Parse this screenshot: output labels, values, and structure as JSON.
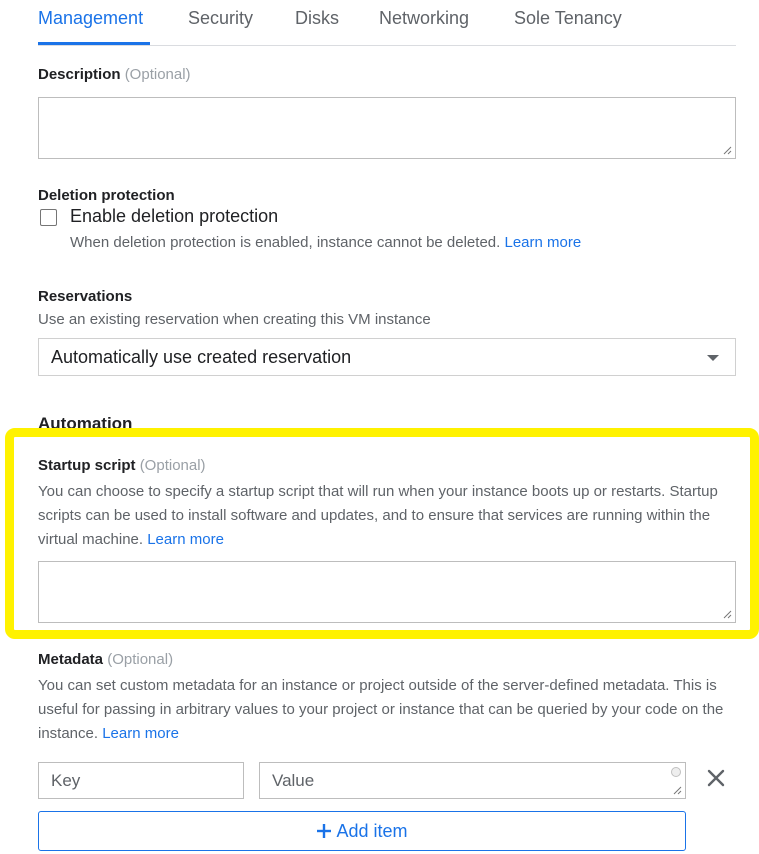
{
  "tabs": [
    {
      "label": "Management",
      "active": true
    },
    {
      "label": "Security",
      "active": false
    },
    {
      "label": "Disks",
      "active": false
    },
    {
      "label": "Networking",
      "active": false
    },
    {
      "label": "Sole Tenancy",
      "active": false
    }
  ],
  "description": {
    "label": "Description",
    "optional": "(Optional)",
    "value": ""
  },
  "deletion_protection": {
    "label": "Deletion protection",
    "checkbox_label": "Enable deletion protection",
    "checked": false,
    "help_text": "When deletion protection is enabled, instance cannot be deleted.",
    "learn_more": "Learn more"
  },
  "reservations": {
    "label": "Reservations",
    "help_text": "Use an existing reservation when creating this VM instance",
    "selected": "Automatically use created reservation"
  },
  "automation": {
    "heading": "Automation"
  },
  "startup_script": {
    "label": "Startup script",
    "optional": "(Optional)",
    "help_text": "You can choose to specify a startup script that will run when your instance boots up or restarts. Startup scripts can be used to install software and updates, and to ensure that services are running within the virtual machine.",
    "learn_more": "Learn more",
    "value": ""
  },
  "metadata": {
    "label": "Metadata",
    "optional": "(Optional)",
    "help_text": "You can set custom metadata for an instance or project outside of the server-defined metadata. This is useful for passing in arbitrary values to your project or instance that can be queried by your code on the instance.",
    "learn_more": "Learn more",
    "key_placeholder": "Key",
    "value_placeholder": "Value",
    "add_item_label": "Add item"
  },
  "colors": {
    "accent": "#1a73e8",
    "highlight": "#fff200"
  }
}
